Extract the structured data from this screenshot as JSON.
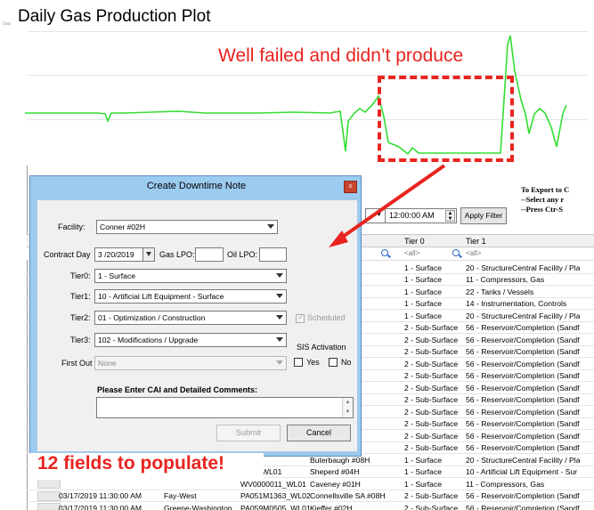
{
  "plot": {
    "title": "Daily Gas Production Plot",
    "tiny_label": "Gas",
    "line_color": "#33dd33",
    "series_values": [
      0.62,
      0.62,
      0.62,
      0.62,
      0.61,
      0.62,
      0.62,
      0.62,
      0.62,
      0.62,
      0.62,
      0.62,
      0.62,
      0.63,
      0.62,
      0.62,
      0.62,
      0.62,
      0.62,
      0.62,
      0.62,
      0.62,
      0.62,
      0.62,
      0.62,
      0.62,
      0.62,
      0.62,
      0.62,
      0.62,
      0.62,
      0.62,
      0.62,
      0.62,
      0.62,
      0.62,
      0.62,
      0.62,
      0.62,
      0.62,
      0.62,
      0.62,
      0.62,
      0.62,
      0.62,
      0.62,
      0.62,
      0.62,
      0.62,
      0.62,
      0.62,
      0.62,
      0.62,
      0.62,
      0.62,
      0.62,
      0.62,
      0.62,
      0.62,
      0.62,
      0.62,
      0.62,
      0.62,
      0.62,
      0.62,
      0.62,
      0.62,
      0.62,
      0.62,
      0.62,
      0.62,
      0.62,
      0.62,
      0.62,
      0.62,
      0.62,
      0.62,
      0.62,
      0.62,
      0.62,
      0.62,
      0.61,
      0.62,
      0.62,
      0.62,
      0.62,
      0.62,
      0.62,
      0.62,
      0.62,
      0.62,
      0.62,
      0.62,
      0.62,
      0.62,
      0.62,
      0.62,
      0.62,
      0.62,
      0.62,
      0.62,
      0.62,
      0.62,
      0.62,
      0.62,
      0.62,
      0.62
    ]
  },
  "annotations": {
    "failure_note": "Well failed and didn’t produce",
    "fields_note": "12 fields to populate!",
    "color": "#e8241f"
  },
  "background_grid": {
    "export_lines": [
      "To Export to C",
      "--Select any r",
      "--Press Ctr-S"
    ],
    "time_value": "12:00:00 AM",
    "apply_label": "Apply Filter",
    "header_tier0": "Tier 0",
    "header_tier1": "Tier 1",
    "filter_all": "<all>",
    "rows": [
      {
        "date": "",
        "loc": "",
        "well": "",
        "name": "",
        "tier0": "1 - Surface",
        "tier1": "20 - StructureCentral Facility / Pla"
      },
      {
        "date": "",
        "loc": "",
        "well": "",
        "name": "",
        "tier0": "1 - Surface",
        "tier1": "11 - Compressors, Gas"
      },
      {
        "date": "",
        "loc": "",
        "well": "",
        "name": "H",
        "tier0": "1 - Surface",
        "tier1": "22 - Tanks / Vessels"
      },
      {
        "date": "",
        "loc": "",
        "well": "",
        "name": "",
        "tier0": "1 - Surface",
        "tier1": "14 - Instrumentation, Controls"
      },
      {
        "date": "",
        "loc": "",
        "well": "",
        "name": "",
        "tier0": "1 - Surface",
        "tier1": "20 - StructureCentral Facility / Pla"
      },
      {
        "date": "",
        "loc": "",
        "well": "",
        "name": "",
        "tier0": "2 - Sub-Surface",
        "tier1": "56 - Reservoir/Completion (Sandf"
      },
      {
        "date": "",
        "loc": "",
        "well": "",
        "name": "",
        "tier0": "2 - Sub-Surface",
        "tier1": "56 - Reservoir/Completion (Sandf"
      },
      {
        "date": "",
        "loc": "",
        "well": "",
        "name": "",
        "tier0": "2 - Sub-Surface",
        "tier1": "56 - Reservoir/Completion (Sandf"
      },
      {
        "date": "",
        "loc": "",
        "well": "",
        "name": "A #08H",
        "tier0": "2 - Sub-Surface",
        "tier1": "56 - Reservoir/Completion (Sandf"
      },
      {
        "date": "",
        "loc": "",
        "well": "",
        "name": "9H",
        "tier0": "2 - Sub-Surface",
        "tier1": "56 - Reservoir/Completion (Sandf"
      },
      {
        "date": "",
        "loc": "",
        "well": "",
        "name": "",
        "tier0": "2 - Sub-Surface",
        "tier1": "56 - Reservoir/Completion (Sandf"
      },
      {
        "date": "",
        "loc": "",
        "well": "",
        "name": "D",
        "tier0": "2 - Sub-Surface",
        "tier1": "56 - Reservoir/Completion (Sandf"
      },
      {
        "date": "",
        "loc": "",
        "well": "",
        "name": "#26H",
        "tier0": "2 - Sub-Surface",
        "tier1": "56 - Reservoir/Completion (Sandf"
      },
      {
        "date": "",
        "loc": "",
        "well": "",
        "name": "4H",
        "tier0": "2 - Sub-Surface",
        "tier1": "56 - Reservoir/Completion (Sandf"
      },
      {
        "date": "",
        "loc": "",
        "well": "",
        "name": "8H",
        "tier0": "2 - Sub-Surface",
        "tier1": "56 - Reservoir/Completion (Sandf"
      },
      {
        "date": "",
        "loc": "",
        "well": "",
        "name": "4H",
        "tier0": "2 - Sub-Surface",
        "tier1": "56 - Reservoir/Completion (Sandf"
      },
      {
        "date": "",
        "loc": "",
        "well": "",
        "name": "Buterbaugh #08H",
        "tier0": "1 - Surface",
        "tier1": "20 - StructureCentral Facility / Pla"
      },
      {
        "date": "",
        "loc": "",
        "well": "1475_WL01",
        "name": "Sheperd #04H",
        "tier0": "1 - Surface",
        "tier1": "10 - Artificial Lift Equipment - Sur"
      },
      {
        "date": "",
        "loc": "",
        "well": "WV0000011_WL01",
        "name": "Caveney #01H",
        "tier0": "1 - Surface",
        "tier1": "11 - Compressors, Gas"
      },
      {
        "date": "03/17/2019 11:30:00 AM",
        "loc": "Fay-West",
        "well": "PA051M1363_WL02",
        "name": "Connellsville SA #08H",
        "tier0": "2 - Sub-Surface",
        "tier1": "56 - Reservoir/Completion (Sandf"
      },
      {
        "date": "03/17/2019 11:30:00 AM",
        "loc": "Greene-Washington",
        "well": "PA059M0505_WL01",
        "name": "Kieffer #02H",
        "tier0": "2 - Sub-Surface",
        "tier1": "56 - Reservoir/Completion (Sandf"
      }
    ]
  },
  "dialog": {
    "title": "Create Downtime Note",
    "close_label": "x",
    "facility_label": "Facility:",
    "facility_value": "Conner #02H",
    "contract_day_label": "Contract Day",
    "contract_day_value": "3 /20/2019",
    "gas_lpo_label": "Gas LPO:",
    "oil_lpo_label": "Oil LPO:",
    "tier0_label": "Tier0:",
    "tier0_value": "1 - Surface",
    "tier1_label": "Tier1:",
    "tier1_value": "10 - Artificial Lift Equipment - Surface",
    "tier2_label": "Tier2:",
    "tier2_value": "01 - Optimization / Construction",
    "tier3_label": "Tier3:",
    "tier3_value": "102 - Modifications / Upgrade",
    "scheduled_label": "Scheduled",
    "sis_label": "SIS Activation",
    "yes_label": "Yes",
    "no_label": "No",
    "first_out_label": "First Out",
    "first_out_value": "None",
    "comments_label": "Please Enter CAI and Detailed Comments:",
    "submit_label": "Submit",
    "cancel_label": "Cancel"
  }
}
